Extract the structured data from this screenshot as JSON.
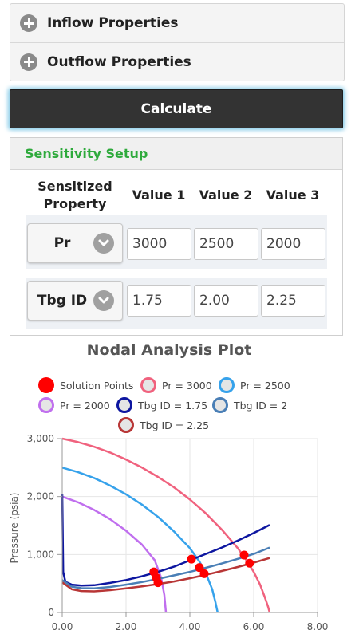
{
  "accordion": {
    "items": [
      {
        "label": "Inflow Properties"
      },
      {
        "label": "Outflow Properties"
      }
    ]
  },
  "calculate_label": "Calculate",
  "sensitivity": {
    "title": "Sensitivity Setup",
    "headers": [
      "Sensitized Property",
      "Value 1",
      "Value 2",
      "Value 3"
    ],
    "rows": [
      {
        "property": "Pr",
        "values": [
          "3000",
          "2500",
          "2000"
        ]
      },
      {
        "property": "Tbg ID",
        "values": [
          "1.75",
          "2.00",
          "2.25"
        ]
      }
    ]
  },
  "colors": {
    "accent_green": "#2eaa3c",
    "button_dark": "#333333",
    "pr3000": "#f0627e",
    "pr2500": "#36a2eb",
    "pr2000": "#c06fee",
    "tbg175": "#0d16a0",
    "tbg2": "#4a7fb6",
    "tbg225": "#b83636",
    "solution": "#ff0000"
  },
  "chart_data": {
    "type": "line",
    "title": "Nodal Analysis Plot",
    "xlabel": "",
    "ylabel": "Pressure (psia)",
    "xlim": [
      0,
      8
    ],
    "ylim": [
      0,
      3000
    ],
    "x_ticks": [
      "0.00",
      "2.00",
      "4.00",
      "6.00",
      "8.00"
    ],
    "y_ticks": [
      "0",
      "1,000",
      "2,000",
      "3,000"
    ],
    "legend": [
      "Solution Points",
      "Pr = 3000",
      "Pr = 2500",
      "Pr = 2000",
      "Tbg ID = 1.75",
      "Tbg ID = 2",
      "Tbg ID = 2.25"
    ],
    "series": [
      {
        "name": "Pr = 3000",
        "color": "#f0627e",
        "points": [
          [
            0.0,
            3000
          ],
          [
            0.5,
            2940
          ],
          [
            1.0,
            2860
          ],
          [
            1.5,
            2760
          ],
          [
            2.0,
            2640
          ],
          [
            2.5,
            2500
          ],
          [
            3.0,
            2340
          ],
          [
            3.5,
            2160
          ],
          [
            4.0,
            1950
          ],
          [
            4.5,
            1710
          ],
          [
            5.0,
            1430
          ],
          [
            5.5,
            1110
          ],
          [
            5.8,
            880
          ],
          [
            6.0,
            700
          ],
          [
            6.2,
            480
          ],
          [
            6.35,
            260
          ],
          [
            6.45,
            100
          ],
          [
            6.5,
            0
          ]
        ]
      },
      {
        "name": "Pr = 2500",
        "color": "#36a2eb",
        "points": [
          [
            0.0,
            2500
          ],
          [
            0.5,
            2420
          ],
          [
            1.0,
            2320
          ],
          [
            1.5,
            2190
          ],
          [
            2.0,
            2040
          ],
          [
            2.5,
            1860
          ],
          [
            3.0,
            1650
          ],
          [
            3.5,
            1400
          ],
          [
            4.0,
            1110
          ],
          [
            4.3,
            880
          ],
          [
            4.5,
            680
          ],
          [
            4.7,
            400
          ],
          [
            4.8,
            180
          ],
          [
            4.87,
            0
          ]
        ]
      },
      {
        "name": "Pr = 2000",
        "color": "#c06fee",
        "points": [
          [
            0.0,
            2000
          ],
          [
            0.5,
            1900
          ],
          [
            1.0,
            1770
          ],
          [
            1.5,
            1610
          ],
          [
            2.0,
            1410
          ],
          [
            2.5,
            1170
          ],
          [
            2.9,
            900
          ],
          [
            3.1,
            600
          ],
          [
            3.2,
            300
          ],
          [
            3.25,
            0
          ]
        ]
      },
      {
        "name": "Tbg ID = 1.75",
        "color": "#0d16a0",
        "points": [
          [
            0.0,
            2050
          ],
          [
            0.03,
            700
          ],
          [
            0.1,
            530
          ],
          [
            0.3,
            480
          ],
          [
            0.6,
            465
          ],
          [
            1.0,
            470
          ],
          [
            1.5,
            510
          ],
          [
            2.0,
            560
          ],
          [
            2.5,
            625
          ],
          [
            3.0,
            700
          ],
          [
            3.5,
            790
          ],
          [
            4.0,
            900
          ],
          [
            4.5,
            1010
          ],
          [
            5.0,
            1120
          ],
          [
            5.5,
            1240
          ],
          [
            6.0,
            1370
          ],
          [
            6.5,
            1510
          ]
        ]
      },
      {
        "name": "Tbg ID = 2",
        "color": "#4a7fb6",
        "points": [
          [
            0.0,
            560
          ],
          [
            0.3,
            445
          ],
          [
            0.6,
            420
          ],
          [
            1.0,
            415
          ],
          [
            1.5,
            440
          ],
          [
            2.0,
            480
          ],
          [
            2.5,
            525
          ],
          [
            3.0,
            580
          ],
          [
            3.5,
            640
          ],
          [
            4.0,
            700
          ],
          [
            4.5,
            770
          ],
          [
            5.0,
            845
          ],
          [
            5.5,
            925
          ],
          [
            6.0,
            1010
          ],
          [
            6.5,
            1120
          ]
        ]
      },
      {
        "name": "Tbg ID = 2.25",
        "color": "#b83636",
        "points": [
          [
            0.0,
            520
          ],
          [
            0.3,
            400
          ],
          [
            0.6,
            370
          ],
          [
            1.0,
            365
          ],
          [
            1.5,
            385
          ],
          [
            2.0,
            415
          ],
          [
            2.5,
            450
          ],
          [
            3.0,
            490
          ],
          [
            3.5,
            535
          ],
          [
            4.0,
            590
          ],
          [
            4.5,
            650
          ],
          [
            5.0,
            715
          ],
          [
            5.5,
            785
          ],
          [
            6.0,
            860
          ],
          [
            6.5,
            940
          ]
        ]
      }
    ],
    "solution_points": [
      [
        2.87,
        700
      ],
      [
        2.95,
        600
      ],
      [
        3.0,
        515
      ],
      [
        4.05,
        920
      ],
      [
        4.3,
        775
      ],
      [
        4.45,
        670
      ],
      [
        5.7,
        990
      ],
      [
        5.87,
        850
      ]
    ]
  }
}
